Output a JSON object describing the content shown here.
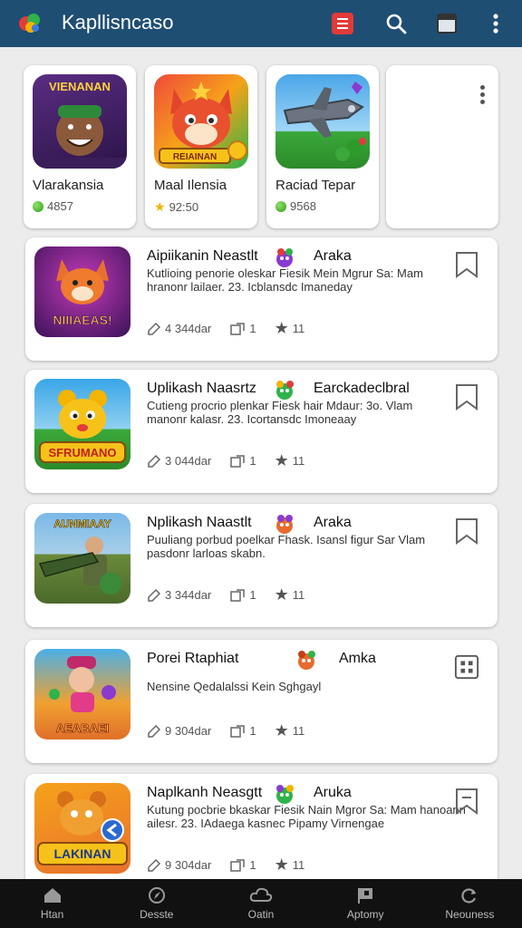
{
  "appbar": {
    "title": "Kapllisncaso",
    "icons": [
      "app-logo-icon",
      "document-icon",
      "search-icon",
      "window-icon",
      "more-vert-icon"
    ],
    "accent": "#1f4e73",
    "document_color": "#e03a3a"
  },
  "featured": [
    {
      "name": "Vlarakansia",
      "rating": "4857",
      "rating_icon": "green-dot-icon",
      "thumb_label": "VIENANAN"
    },
    {
      "name": "Maal Ilensia",
      "rating": "92:50",
      "rating_icon": "star-icon",
      "thumb_label": "REIAINAN"
    },
    {
      "name": "Raciad Tepar",
      "rating": "9568",
      "rating_icon": "green-dot-icon",
      "thumb_label": ""
    }
  ],
  "items": [
    {
      "title": "Aipiikanin Neastlt",
      "tag": "Araka",
      "desc": "Kutlioing penorie oleskar Fiesik Mein Mgrur Sa: Mam hranonr lailaer. 23. Icblansdc Imaneday",
      "downloads": "4 344dar",
      "shares": "1",
      "stars": "11",
      "thumb_label": "NIIIAEAS!",
      "action_icon": "bookmark-icon"
    },
    {
      "title": "Uplikash Naasrtz",
      "tag": "Earckadeclbral",
      "desc": "Cutieng procrio plenkar Fiesk hair Mdaur: 3o. Vlam manonr kalasr. 23. Icortansdc Imoneaay",
      "downloads": "3 044dar",
      "shares": "1",
      "stars": "11",
      "thumb_label": "SFRUMANO",
      "action_icon": "bookmark-icon"
    },
    {
      "title": "Nplikash Naastlt",
      "tag": "Araka",
      "desc": "Puuliang porbud poelkar Fhask. Isansl figur Sar Vlam pasdonr larloas skabn.",
      "downloads": "3 344dar",
      "shares": "1",
      "stars": "11",
      "thumb_label": "AUNMIAAY",
      "action_icon": "bookmark-icon"
    },
    {
      "title": "Porei Rtaphiat",
      "tag": "Amka",
      "desc": "Nensine Qedalalssi Kein Sghgayl",
      "downloads": "9 304dar",
      "shares": "1",
      "stars": "11",
      "thumb_label": "AEABAEI",
      "action_icon": "dice-icon"
    },
    {
      "title": "Naplkanh Neasgtt",
      "tag": "Aruka",
      "desc": "Kutung pocbrie bkaskar Fiesik Nain Mgror Sa: Mam hanoann ailesr. 23. IAdaega kasnec Pipamy Virnengae",
      "downloads": "9 304dar",
      "shares": "1",
      "stars": "11",
      "thumb_label": "LAKINAN",
      "action_icon": "bookmark-dash-icon"
    }
  ],
  "bottom_nav": [
    {
      "label": "Htan",
      "icon": "home-icon"
    },
    {
      "label": "Desste",
      "icon": "compass-icon"
    },
    {
      "label": "Oatin",
      "icon": "cloud-icon"
    },
    {
      "label": "Aptomy",
      "icon": "flag-icon"
    },
    {
      "label": "Neouness",
      "icon": "refresh-icon"
    }
  ]
}
